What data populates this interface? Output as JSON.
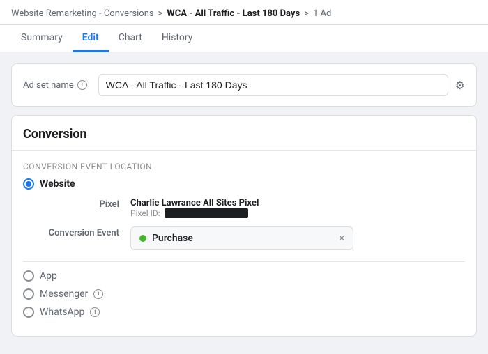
{
  "breadcrumb": {
    "item1": "Website Remarketing - Conversions",
    "separator1": ">",
    "item2": "WCA - All Traffic - Last 180 Days",
    "separator2": ">",
    "item3": "1 Ad"
  },
  "tabs": {
    "items": [
      {
        "label": "Summary",
        "active": false
      },
      {
        "label": "Edit",
        "active": true
      },
      {
        "label": "Chart",
        "active": false
      },
      {
        "label": "History",
        "active": false
      }
    ]
  },
  "adset": {
    "label": "Ad set name",
    "value": "WCA - All Traffic - Last 180 Days",
    "gear_icon": "⚙"
  },
  "conversion": {
    "title": "Conversion",
    "event_location_label": "Conversion Event Location",
    "website_option": "Website",
    "pixel_label": "Pixel",
    "pixel_name": "Charlie Lawrance All Sites Pixel",
    "pixel_id_label": "Pixel ID:",
    "conversion_event_label": "Conversion Event",
    "conversion_event_value": "Purchase",
    "close_icon": "×",
    "other_options": [
      {
        "label": "App"
      },
      {
        "label": "Messenger"
      },
      {
        "label": "WhatsApp"
      }
    ]
  },
  "icons": {
    "info": "i",
    "gear": "⚙",
    "close": "×"
  }
}
